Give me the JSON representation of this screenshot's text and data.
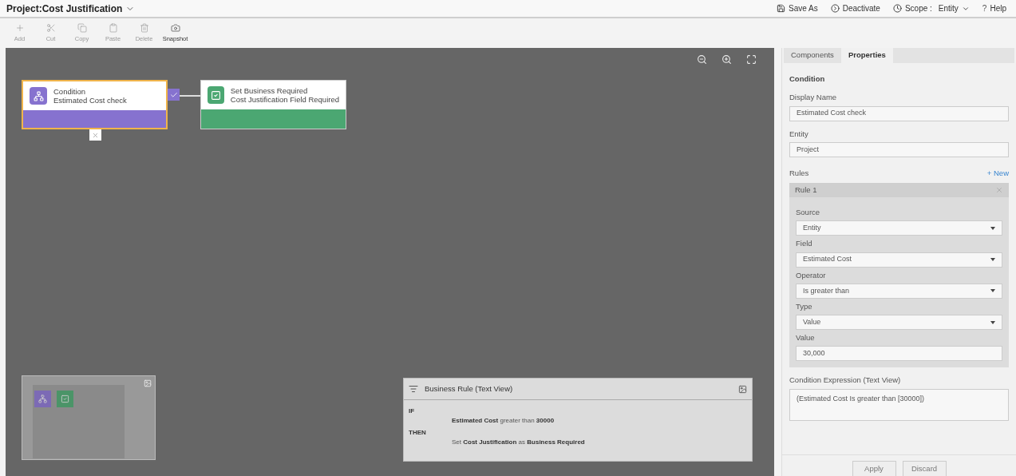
{
  "header": {
    "title": "Project:Cost Justification",
    "actions": [
      {
        "kind": "save",
        "label": "Save As"
      },
      {
        "kind": "deactivate",
        "label": "Deactivate"
      },
      {
        "kind": "scope",
        "label": "Scope :",
        "value": "Entity"
      },
      {
        "kind": "help",
        "icon": "?",
        "label": "Help"
      }
    ]
  },
  "toolbar": [
    {
      "kind": "add",
      "label": "Add",
      "disabled": true
    },
    {
      "kind": "cut",
      "label": "Cut",
      "disabled": true
    },
    {
      "kind": "copy",
      "label": "Copy",
      "disabled": true
    },
    {
      "kind": "paste",
      "label": "Paste",
      "disabled": true
    },
    {
      "kind": "delete",
      "label": "Delete",
      "disabled": true
    },
    {
      "kind": "snapshot",
      "label": "Snapshot",
      "disabled": false
    }
  ],
  "canvas": {
    "nodes": [
      {
        "kind": "condition",
        "title": "Condition",
        "subtitle": "Estimated Cost check",
        "selected": true
      },
      {
        "kind": "action",
        "title": "Set Business Required",
        "subtitle": "Cost Justification Field Required",
        "selected": false
      }
    ],
    "text_view": {
      "title": "Business Rule (Text View)",
      "lines": [
        {
          "keyword": "IF",
          "text": "**Estimated Cost** greater than **30000**"
        },
        {
          "keyword": "THEN",
          "text": "Set **Cost Justification** as **Business Required**"
        }
      ]
    }
  },
  "panel": {
    "tabs": [
      {
        "label": "Components",
        "selected": false
      },
      {
        "label": "Properties",
        "selected": true
      }
    ],
    "heading": "Condition",
    "display_name": {
      "label": "Display Name",
      "value": "Estimated Cost check"
    },
    "entity": {
      "label": "Entity",
      "value": "Project"
    },
    "rules_label": "Rules",
    "new_link": "+ New",
    "rule": {
      "title": "Rule 1",
      "fields": [
        {
          "kind": "select",
          "label": "Source",
          "value": "Entity"
        },
        {
          "kind": "select",
          "label": "Field",
          "value": "Estimated Cost"
        },
        {
          "kind": "select",
          "label": "Operator",
          "value": "Is greater than"
        },
        {
          "kind": "select",
          "label": "Type",
          "value": "Value"
        },
        {
          "kind": "input",
          "label": "Value",
          "value": "30,000"
        }
      ]
    },
    "expression": {
      "label": "Condition Expression (Text View)",
      "value": "(Estimated Cost Is greater than [30000])"
    },
    "buttons": [
      "Apply",
      "Discard"
    ]
  }
}
